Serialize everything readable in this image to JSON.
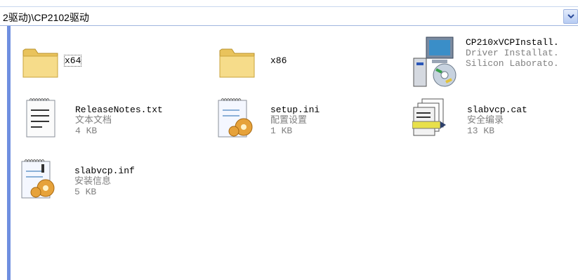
{
  "address": {
    "path": "2驱动)\\CP2102驱动"
  },
  "files": [
    {
      "name": "x64",
      "type": "",
      "size": ""
    },
    {
      "name": "x86",
      "type": "",
      "size": ""
    },
    {
      "name": "CP210xVCPInstall.",
      "type": "Driver Installat.",
      "size": "Silicon Laborato."
    },
    {
      "name": "ReleaseNotes.txt",
      "type": "文本文档",
      "size": "4 KB"
    },
    {
      "name": "setup.ini",
      "type": "配置设置",
      "size": "1 KB"
    },
    {
      "name": "slabvcp.cat",
      "type": "安全编录",
      "size": "13 KB"
    },
    {
      "name": "slabvcp.inf",
      "type": "安装信息",
      "size": "5 KB"
    }
  ],
  "icons": [
    "folder-icon",
    "folder-icon",
    "installer-icon",
    "text-document-icon",
    "config-settings-icon",
    "security-catalog-icon",
    "setup-info-icon"
  ]
}
